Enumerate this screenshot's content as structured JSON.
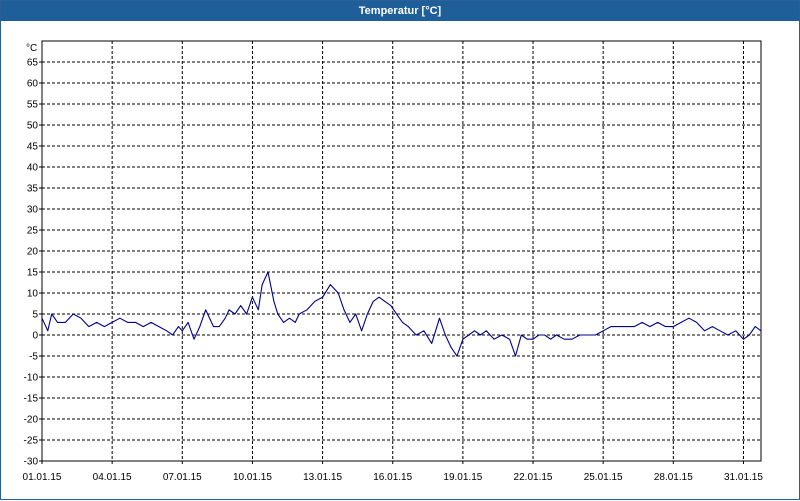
{
  "window": {
    "title": "Temperatur [°C]"
  },
  "chart_data": {
    "type": "line",
    "title": "Temperatur [°C]",
    "ylabel": "°C",
    "xlabel": "",
    "ylim": [
      -30,
      70
    ],
    "y_ticks": [
      -30,
      -25,
      -20,
      -15,
      -10,
      -5,
      0,
      5,
      10,
      15,
      20,
      25,
      30,
      35,
      40,
      45,
      50,
      55,
      60,
      65
    ],
    "x_range_days": [
      1,
      31.75
    ],
    "x_ticks": [
      "01.01.15",
      "04.01.15",
      "07.01.15",
      "10.01.15",
      "13.01.15",
      "16.01.15",
      "19.01.15",
      "22.01.15",
      "25.01.15",
      "28.01.15",
      "31.01.15"
    ],
    "grid": true,
    "line_color": "#00008b",
    "series": [
      {
        "x_dates": [
          "01.01.15 00:00",
          "01.01.15 06:00",
          "01.01.15 10:00",
          "01.01.15 16:00",
          "02.01.15 00:00",
          "02.01.15 08:00",
          "02.01.15 16:00",
          "03.01.15 00:00",
          "03.01.15 08:00",
          "03.01.15 16:00",
          "04.01.15 00:00",
          "04.01.15 08:00",
          "04.01.15 16:00",
          "05.01.15 00:00",
          "05.01.15 08:00",
          "05.01.15 16:00",
          "06.01.15 00:00",
          "06.01.15 08:00",
          "06.01.15 14:00",
          "06.01.15 20:00",
          "07.01.15 00:00",
          "07.01.15 06:00",
          "07.01.15 12:00",
          "07.01.15 18:00",
          "08.01.15 00:00",
          "08.01.15 08:00",
          "08.01.15 14:00",
          "08.01.15 20:00",
          "09.01.15 00:00",
          "09.01.15 06:00",
          "09.01.15 12:00",
          "09.01.15 18:00",
          "10.01.15 00:00",
          "10.01.15 06:00",
          "10.01.15 10:00",
          "10.01.15 16:00",
          "10.01.15 22:00",
          "11.01.15 02:00",
          "11.01.15 08:00",
          "11.01.15 14:00",
          "11.01.15 20:00",
          "12.01.15 00:00",
          "12.01.15 08:00",
          "12.01.15 16:00",
          "13.01.15 00:00",
          "13.01.15 08:00",
          "13.01.15 16:00",
          "13.01.15 22:00",
          "14.01.15 04:00",
          "14.01.15 10:00",
          "14.01.15 16:00",
          "14.01.15 22:00",
          "15.01.15 04:00",
          "15.01.15 10:00",
          "15.01.15 16:00",
          "15.01.15 22:00",
          "16.01.15 04:00",
          "16.01.15 10:00",
          "16.01.15 16:00",
          "17.01.15 00:00",
          "17.01.15 08:00",
          "17.01.15 16:00",
          "18.01.15 00:00",
          "18.01.15 06:00",
          "18.01.15 12:00",
          "18.01.15 18:00",
          "19.01.15 00:00",
          "19.01.15 06:00",
          "19.01.15 12:00",
          "19.01.15 18:00",
          "20.01.15 00:00",
          "20.01.15 08:00",
          "20.01.15 16:00",
          "21.01.15 00:00",
          "21.01.15 06:00",
          "21.01.15 12:00",
          "21.01.15 18:00",
          "22.01.15 00:00",
          "22.01.15 06:00",
          "22.01.15 12:00",
          "22.01.15 18:00",
          "23.01.15 00:00",
          "23.01.15 08:00",
          "23.01.15 16:00",
          "24.01.15 00:00",
          "24.01.15 08:00",
          "24.01.15 16:00",
          "25.01.15 00:00",
          "25.01.15 08:00",
          "25.01.15 16:00",
          "26.01.15 00:00",
          "26.01.15 08:00",
          "26.01.15 16:00",
          "27.01.15 00:00",
          "27.01.15 08:00",
          "27.01.15 16:00",
          "28.01.15 00:00",
          "28.01.15 08:00",
          "28.01.15 16:00",
          "29.01.15 00:00",
          "29.01.15 08:00",
          "29.01.15 16:00",
          "30.01.15 00:00",
          "30.01.15 08:00",
          "30.01.15 16:00",
          "31.01.15 00:00",
          "31.01.15 06:00",
          "31.01.15 12:00",
          "31.01.15 18:00"
        ],
        "values": [
          4,
          1,
          5,
          3,
          3,
          5,
          4,
          2,
          3,
          2,
          3,
          4,
          3,
          3,
          2,
          3,
          2,
          1,
          0,
          2,
          1,
          3,
          -1,
          2,
          6,
          2,
          2,
          4,
          6,
          5,
          7,
          5,
          9,
          6,
          12,
          15,
          8,
          5,
          3,
          4,
          3,
          5,
          6,
          8,
          9,
          12,
          10,
          6,
          3,
          5,
          1,
          5,
          8,
          9,
          8,
          7,
          5,
          3,
          2,
          0,
          1,
          -2,
          4,
          0,
          -3,
          -5,
          -1,
          0,
          1,
          0,
          1,
          -1,
          0,
          -1,
          -5,
          0,
          -1,
          -1,
          0,
          0,
          -1,
          0,
          -1,
          -1,
          0,
          0,
          0,
          1,
          2,
          2,
          2,
          2,
          3,
          2,
          3,
          2,
          2,
          3,
          4,
          3,
          1,
          2,
          1,
          0,
          1,
          -1,
          0,
          2,
          1
        ]
      }
    ]
  }
}
